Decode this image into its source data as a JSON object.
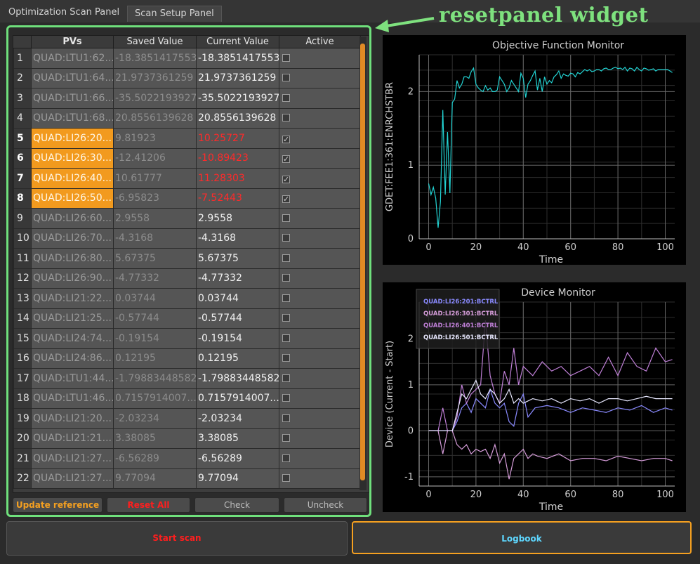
{
  "tabs": [
    "Optimization Scan Panel",
    "Scan Setup Panel"
  ],
  "annotation": "resetpanel widget",
  "table": {
    "headers": [
      "",
      "PVs",
      "Saved Value",
      "Current Value",
      "Active"
    ],
    "rows": [
      {
        "n": "1",
        "pv": "QUAD:LTU1:62...",
        "saved": "-18.3851417553",
        "current": "-18.3851417553",
        "active": false,
        "hl": false,
        "red": false
      },
      {
        "n": "2",
        "pv": "QUAD:LTU1:64...",
        "saved": "21.9737361259",
        "current": "21.9737361259",
        "active": false,
        "hl": false,
        "red": false
      },
      {
        "n": "3",
        "pv": "QUAD:LTU1:66...",
        "saved": "-35.5022193927",
        "current": "-35.5022193927",
        "active": false,
        "hl": false,
        "red": false
      },
      {
        "n": "4",
        "pv": "QUAD:LTU1:68...",
        "saved": "20.8556139628",
        "current": "20.8556139628",
        "active": false,
        "hl": false,
        "red": false
      },
      {
        "n": "5",
        "pv": "QUAD:LI26:20...",
        "saved": "9.81923",
        "current": "10.25727",
        "active": true,
        "hl": true,
        "red": true
      },
      {
        "n": "6",
        "pv": "QUAD:LI26:30...",
        "saved": "-12.41206",
        "current": "-10.89423",
        "active": true,
        "hl": true,
        "red": true
      },
      {
        "n": "7",
        "pv": "QUAD:LI26:40...",
        "saved": "10.61777",
        "current": "11.28303",
        "active": true,
        "hl": true,
        "red": true
      },
      {
        "n": "8",
        "pv": "QUAD:LI26:50...",
        "saved": "-6.95823",
        "current": "-7.52443",
        "active": true,
        "hl": true,
        "red": true
      },
      {
        "n": "9",
        "pv": "QUAD:LI26:60...",
        "saved": "2.9558",
        "current": "2.9558",
        "active": false,
        "hl": false,
        "red": false
      },
      {
        "n": "10",
        "pv": "QUAD:LI26:70...",
        "saved": "-4.3168",
        "current": "-4.3168",
        "active": false,
        "hl": false,
        "red": false
      },
      {
        "n": "11",
        "pv": "QUAD:LI26:80...",
        "saved": "5.67375",
        "current": "5.67375",
        "active": false,
        "hl": false,
        "red": false
      },
      {
        "n": "12",
        "pv": "QUAD:LI26:90...",
        "saved": "-4.77332",
        "current": "-4.77332",
        "active": false,
        "hl": false,
        "red": false
      },
      {
        "n": "13",
        "pv": "QUAD:LI21:22...",
        "saved": "0.03744",
        "current": "0.03744",
        "active": false,
        "hl": false,
        "red": false
      },
      {
        "n": "14",
        "pv": "QUAD:LI21:25...",
        "saved": "-0.57744",
        "current": "-0.57744",
        "active": false,
        "hl": false,
        "red": false
      },
      {
        "n": "15",
        "pv": "QUAD:LI24:74...",
        "saved": "-0.19154",
        "current": "-0.19154",
        "active": false,
        "hl": false,
        "red": false
      },
      {
        "n": "16",
        "pv": "QUAD:LI24:86...",
        "saved": "0.12195",
        "current": "0.12195",
        "active": false,
        "hl": false,
        "red": false
      },
      {
        "n": "17",
        "pv": "QUAD:LTU1:44...",
        "saved": "-1.79883448582",
        "current": "-1.79883448582",
        "active": false,
        "hl": false,
        "red": false
      },
      {
        "n": "18",
        "pv": "QUAD:LTU1:46...",
        "saved": "0.7157914007...",
        "current": "0.7157914007...",
        "active": false,
        "hl": false,
        "red": false
      },
      {
        "n": "19",
        "pv": "QUAD:LI21:20...",
        "saved": "-2.03234",
        "current": "-2.03234",
        "active": false,
        "hl": false,
        "red": false
      },
      {
        "n": "20",
        "pv": "QUAD:LI21:21...",
        "saved": "3.38085",
        "current": "3.38085",
        "active": false,
        "hl": false,
        "red": false
      },
      {
        "n": "21",
        "pv": "QUAD:LI21:27...",
        "saved": "-6.56289",
        "current": "-6.56289",
        "active": false,
        "hl": false,
        "red": false
      },
      {
        "n": "22",
        "pv": "QUAD:LI21:27...",
        "saved": "9.77094",
        "current": "9.77094",
        "active": false,
        "hl": false,
        "red": false
      }
    ]
  },
  "buttons": {
    "update_reference": "Update reference",
    "reset_all": "Reset All",
    "check": "Check",
    "uncheck": "Uncheck",
    "start_scan": "Start scan",
    "logbook": "Logbook"
  },
  "chart_data": [
    {
      "type": "line",
      "title": "Objective Function Monitor",
      "xlabel": "Time",
      "ylabel": "GDET:FEE1:361:ENRCHSTBR",
      "xlim": [
        -4,
        104
      ],
      "ylim": [
        0,
        2.5
      ],
      "xticks": [
        0,
        20,
        40,
        60,
        80,
        100
      ],
      "yticks": [
        0,
        1,
        2
      ],
      "grid": true,
      "series": [
        {
          "color": "#22d3d3",
          "x": [
            0,
            1,
            2,
            3,
            4,
            5,
            6,
            7,
            8,
            9,
            10,
            11,
            12,
            13,
            14,
            15,
            16,
            17,
            18,
            19,
            20,
            21,
            22,
            23,
            24,
            25,
            26,
            27,
            28,
            29,
            30,
            31,
            32,
            33,
            34,
            35,
            36,
            37,
            38,
            39,
            40,
            41,
            42,
            43,
            44,
            45,
            46,
            47,
            48,
            49,
            50,
            51,
            52,
            53,
            54,
            55,
            56,
            57,
            58,
            59,
            60,
            61,
            62,
            63,
            64,
            65,
            66,
            67,
            68,
            69,
            70,
            71,
            72,
            73,
            74,
            75,
            76,
            77,
            78,
            79,
            80,
            81,
            82,
            83,
            84,
            85,
            86,
            87,
            88,
            89,
            90,
            91,
            92,
            93,
            94,
            95,
            96,
            97,
            98,
            99,
            100,
            101,
            102,
            103
          ],
          "y": [
            0.75,
            0.6,
            0.7,
            0.55,
            0.15,
            0.5,
            1.75,
            0.6,
            1.45,
            0.62,
            1.85,
            1.9,
            2.15,
            2.05,
            2.1,
            2.2,
            2.2,
            2.18,
            2.27,
            2.32,
            2.1,
            2.05,
            2.02,
            2.0,
            2.08,
            2.02,
            2.05,
            2.0,
            2.0,
            2.02,
            2.2,
            2.15,
            2.1,
            2.0,
            2.05,
            2.15,
            2.1,
            2.05,
            2.0,
            2.25,
            2.18,
            1.92,
            2.1,
            2.15,
            2.22,
            2.28,
            2.02,
            2.18,
            2.0,
            2.2,
            2.1,
            2.15,
            2.12,
            2.2,
            2.23,
            2.28,
            2.18,
            2.24,
            2.22,
            2.21,
            2.25,
            2.24,
            2.2,
            2.26,
            2.24,
            2.27,
            2.3,
            2.28,
            2.3,
            2.27,
            2.28,
            2.3,
            2.3,
            2.28,
            2.31,
            2.32,
            2.3,
            2.3,
            2.32,
            2.33,
            2.31,
            2.32,
            2.3,
            2.33,
            2.28,
            2.32,
            2.31,
            2.28,
            2.33,
            2.3,
            2.28,
            2.32,
            2.31,
            2.29,
            2.3,
            2.31,
            2.28,
            2.3,
            2.3,
            2.3,
            2.3,
            2.3,
            2.28,
            2.26
          ]
        }
      ]
    },
    {
      "type": "line",
      "title": "Device Monitor",
      "xlabel": "Time",
      "ylabel": "Device (Current - Start)",
      "xlim": [
        -4,
        104
      ],
      "ylim": [
        -1.2,
        2.8
      ],
      "xticks": [
        0,
        20,
        40,
        60,
        80,
        100
      ],
      "yticks": [
        -1,
        0,
        1,
        2
      ],
      "grid": true,
      "legend": "top-left",
      "series": [
        {
          "name": "QUAD:LI26:201:BCTRL",
          "color": "#8a8aff",
          "x": [
            0,
            4,
            8,
            10,
            12,
            14,
            16,
            18,
            20,
            22,
            24,
            26,
            28,
            30,
            32,
            34,
            36,
            38,
            40,
            42,
            45,
            50,
            55,
            60,
            65,
            70,
            75,
            80,
            85,
            90,
            95,
            100,
            103
          ],
          "y": [
            0,
            0,
            0,
            0,
            0.2,
            0.5,
            0.6,
            0.4,
            0.7,
            0.6,
            0.5,
            0.9,
            0.6,
            0.5,
            0.6,
            0.2,
            0.1,
            0.6,
            0.8,
            0.3,
            0.5,
            0.55,
            0.5,
            0.4,
            0.5,
            0.45,
            0.4,
            0.5,
            0.45,
            0.55,
            0.4,
            0.5,
            0.45
          ]
        },
        {
          "name": "QUAD:LI26:301:BCTRL",
          "color": "#d59cd9",
          "x": [
            0,
            4,
            6,
            8,
            10,
            12,
            14,
            16,
            18,
            20,
            22,
            24,
            26,
            28,
            30,
            32,
            34,
            36,
            38,
            40,
            42,
            44,
            46,
            50,
            55,
            60,
            65,
            70,
            75,
            80,
            85,
            90,
            95,
            100,
            103
          ],
          "y": [
            0,
            0,
            -0.5,
            0,
            0,
            -0.3,
            -0.4,
            -0.3,
            -0.5,
            -0.4,
            -0.45,
            -0.4,
            -0.6,
            -0.3,
            -0.7,
            -0.5,
            -1.05,
            -0.6,
            -0.5,
            -0.4,
            -0.6,
            -0.5,
            -0.55,
            -0.6,
            -0.5,
            -0.65,
            -0.6,
            -0.6,
            -0.65,
            -0.55,
            -0.6,
            -0.65,
            -0.6,
            -0.6,
            -0.65
          ]
        },
        {
          "name": "QUAD:LI26:401:BCTRL",
          "color": "#c080d8",
          "x": [
            0,
            4,
            6,
            8,
            10,
            12,
            14,
            16,
            18,
            20,
            22,
            24,
            26,
            28,
            30,
            32,
            34,
            36,
            38,
            40,
            44,
            48,
            52,
            56,
            60,
            64,
            68,
            72,
            76,
            80,
            84,
            88,
            92,
            96,
            100,
            103
          ],
          "y": [
            0,
            0,
            0.5,
            0,
            0,
            0.3,
            1.0,
            0.6,
            0.8,
            0.9,
            1.0,
            2.4,
            1.2,
            0.8,
            0.6,
            1.3,
            1.0,
            1.8,
            1.0,
            1.4,
            1.2,
            1.5,
            1.3,
            1.4,
            1.2,
            1.3,
            1.4,
            1.2,
            1.6,
            1.2,
            1.7,
            1.4,
            1.3,
            1.8,
            1.5,
            1.55
          ]
        },
        {
          "name": "QUAD:LI26:501:BCTRL",
          "color": "#e8e8ff",
          "x": [
            0,
            4,
            8,
            10,
            12,
            14,
            16,
            18,
            20,
            22,
            24,
            26,
            28,
            30,
            32,
            34,
            36,
            38,
            40,
            44,
            48,
            52,
            56,
            60,
            64,
            68,
            72,
            76,
            80,
            84,
            88,
            92,
            96,
            100,
            103
          ],
          "y": [
            0,
            0,
            0,
            0,
            0.4,
            0.8,
            0.7,
            0.9,
            1.1,
            0.8,
            0.7,
            0.9,
            0.8,
            0.6,
            0.7,
            0.9,
            0.6,
            0.7,
            0.6,
            0.7,
            0.65,
            0.7,
            0.6,
            0.7,
            0.65,
            0.7,
            0.6,
            0.7,
            0.7,
            0.65,
            0.7,
            0.75,
            0.7,
            0.7,
            0.7
          ]
        }
      ]
    }
  ]
}
